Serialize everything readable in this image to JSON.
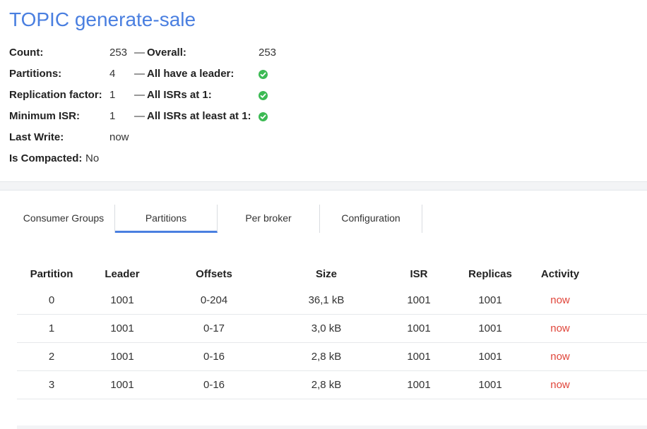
{
  "page": {
    "title": "TOPIC generate-sale"
  },
  "summary": {
    "count_label": "Count:",
    "count_value": "253",
    "overall_label": "Overall:",
    "overall_value": "253",
    "partitions_label": "Partitions:",
    "partitions_value": "4",
    "leader_label": "All have a leader:",
    "replication_label": "Replication factor:",
    "replication_value": "1",
    "isrs_at_1_label": "All ISRs at 1:",
    "min_isr_label": "Minimum ISR:",
    "min_isr_value": "1",
    "isrs_at_least_label": "All ISRs at least at 1:",
    "last_write_label": "Last Write:",
    "last_write_value": "now",
    "compacted_label": "Is Compacted:",
    "compacted_value": "No",
    "dash": "—",
    "check_icon": "check-circle-icon",
    "check_color": "#3cba54"
  },
  "tabs": [
    {
      "label": "Consumer Groups",
      "active": false
    },
    {
      "label": "Partitions",
      "active": true
    },
    {
      "label": "Per broker",
      "active": false
    },
    {
      "label": "Configuration",
      "active": false
    }
  ],
  "table": {
    "columns": [
      "Partition",
      "Leader",
      "Offsets",
      "Size",
      "ISR",
      "Replicas",
      "Activity"
    ],
    "rows": [
      [
        "0",
        "1001",
        "0-204",
        "36,1 kB",
        "1001",
        "1001",
        "now"
      ],
      [
        "1",
        "1001",
        "0-17",
        "3,0 kB",
        "1001",
        "1001",
        "now"
      ],
      [
        "2",
        "1001",
        "0-16",
        "2,8 kB",
        "1001",
        "1001",
        "now"
      ],
      [
        "3",
        "1001",
        "0-16",
        "2,8 kB",
        "1001",
        "1001",
        "now"
      ]
    ]
  },
  "colors": {
    "title": "#4a7fe0",
    "activity": "#e0453a",
    "tab_active": "#4a7fe0"
  }
}
